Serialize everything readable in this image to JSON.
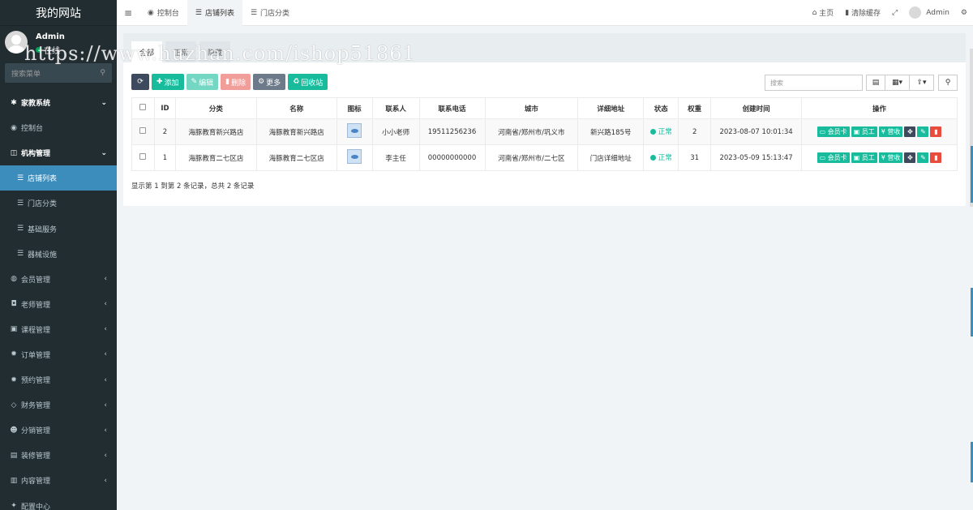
{
  "sidebar": {
    "logo": "我的网站",
    "user_name": "Admin",
    "user_status": "在线",
    "search_placeholder": "搜索菜单",
    "items": [
      {
        "label": "家教系统",
        "icon": "✱",
        "type": "header",
        "caret": "⌄"
      },
      {
        "label": "控制台",
        "icon": "◉",
        "type": "item"
      },
      {
        "label": "机构管理",
        "icon": "◫",
        "type": "header",
        "caret": "⌄"
      },
      {
        "label": "店铺列表",
        "icon": "☰",
        "type": "sub-active"
      },
      {
        "label": "门店分类",
        "icon": "☰",
        "type": "sub"
      },
      {
        "label": "基础服务",
        "icon": "☰",
        "type": "sub"
      },
      {
        "label": "器械设施",
        "icon": "☰",
        "type": "sub"
      },
      {
        "label": "会员管理",
        "icon": "◍",
        "type": "item",
        "caret": "‹"
      },
      {
        "label": "老师管理",
        "icon": "◘",
        "type": "item",
        "caret": "‹"
      },
      {
        "label": "课程管理",
        "icon": "▣",
        "type": "item",
        "caret": "‹"
      },
      {
        "label": "订单管理",
        "icon": "✹",
        "type": "item",
        "caret": "‹"
      },
      {
        "label": "预约管理",
        "icon": "✹",
        "type": "item",
        "caret": "‹"
      },
      {
        "label": "财务管理",
        "icon": "◇",
        "type": "item",
        "caret": "‹"
      },
      {
        "label": "分销管理",
        "icon": "☻",
        "type": "item",
        "caret": "‹"
      },
      {
        "label": "装修管理",
        "icon": "▤",
        "type": "item",
        "caret": "‹"
      },
      {
        "label": "内容管理",
        "icon": "▥",
        "type": "item",
        "caret": "‹"
      },
      {
        "label": "配置中心",
        "icon": "✦",
        "type": "item",
        "caret": ""
      }
    ]
  },
  "watermark": "https://www.huzhan.com/ishop51861",
  "topbar": {
    "toggle": "≡",
    "tabs": [
      {
        "label": "控制台",
        "icon": "◉",
        "active": false
      },
      {
        "label": "店铺列表",
        "icon": "☰",
        "active": true
      },
      {
        "label": "门店分类",
        "icon": "☰",
        "active": false
      }
    ],
    "home": "主页",
    "clear_cache": "清除缓存",
    "user": "Admin"
  },
  "panel": {
    "tabs": [
      "全部",
      "正常",
      "隐藏"
    ],
    "toolbar": {
      "refresh": "⟳",
      "add": "添加",
      "edit": "编辑",
      "delete": "删除",
      "more": "更多",
      "recycle": "回收站"
    },
    "search_placeholder": "搜索",
    "columns": [
      "",
      "ID",
      "分类",
      "名称",
      "图标",
      "联系人",
      "联系电话",
      "城市",
      "详细地址",
      "状态",
      "权重",
      "创建时间",
      "操作"
    ],
    "rows": [
      {
        "id": "2",
        "category": "海豚教育新兴路店",
        "name": "海豚教育新兴路店",
        "contact": "小小老师",
        "phone": "19511256236",
        "city": "河南省/郑州市/巩义市",
        "address": "新兴路185号",
        "status": "正常",
        "weight": "2",
        "created": "2023-08-07 10:01:34"
      },
      {
        "id": "1",
        "category": "海豚教育二七区店",
        "name": "海豚教育二七区店",
        "contact": "李主任",
        "phone": "00000000000",
        "city": "河南省/郑州市/二七区",
        "address": "门店详细地址",
        "status": "正常",
        "weight": "31",
        "created": "2023-05-09 15:13:47"
      }
    ],
    "ops": {
      "member_card": "会员卡",
      "staff": "员工",
      "revenue": "营收"
    },
    "pager": "显示第 1 到第 2 条记录，总共 2 条记录"
  }
}
